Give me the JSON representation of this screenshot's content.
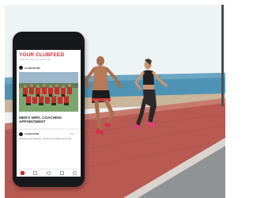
{
  "feed": {
    "title": "YOUR CLUBFEED",
    "subtitle": "Latest news from your favorite club",
    "club_name": "CLUBHUB NRL",
    "post_title": "MEN'S NRFL COACHING APPOINTMENT",
    "second_post": {
      "club_name": "CLUBHUB NRL",
      "time": "3 days",
      "text": "We have a new milestone, continue our clubhub community"
    }
  },
  "tabbar": {
    "icons": [
      "home-icon",
      "calendar-icon",
      "bell-icon",
      "chat-icon",
      "settings-icon"
    ]
  },
  "colors": {
    "accent": "#d42a2a",
    "promenade": "#b85a52",
    "sea": "#4f93b4",
    "sky": "#eef3f6",
    "phone_body": "#17181b"
  }
}
